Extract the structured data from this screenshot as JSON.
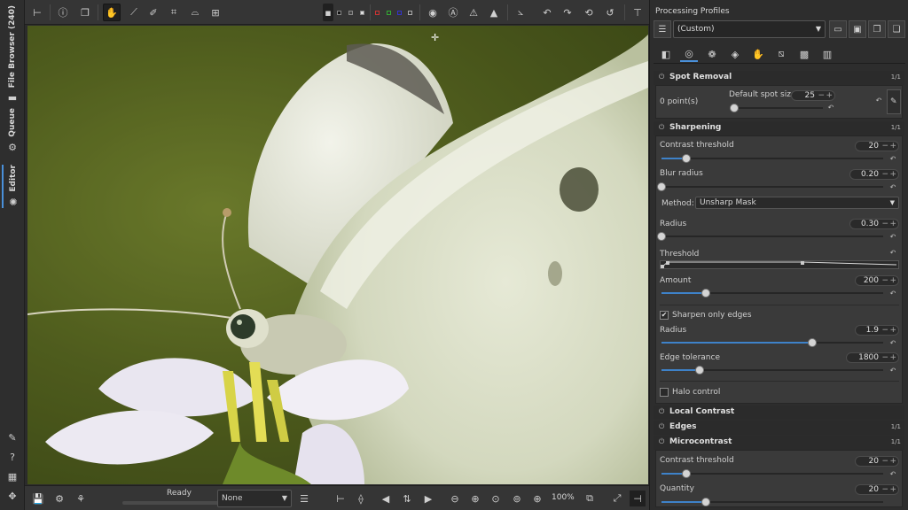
{
  "left_bar": {
    "tabs": [
      {
        "label": "File Browser (240)",
        "icon": "folder-icon"
      },
      {
        "label": "Queue",
        "icon": "gears-icon"
      },
      {
        "label": "Editor",
        "icon": "aperture-icon"
      }
    ],
    "bottom_icons": [
      "pipette-icon",
      "help-icon",
      "shortcuts-icon",
      "move-icon"
    ]
  },
  "top_toolbar": {
    "tools": [
      "hide-panel-icon",
      "info-icon",
      "before-after-icon",
      "hand-icon",
      "white-balance-picker-icon",
      "color-picker-icon",
      "crop-icon",
      "straighten-icon",
      "perspective-icon"
    ],
    "active_tool": "hand-icon",
    "right_tools": [
      "focus-mask-icon",
      "clip-shadows-icon",
      "clip-highlights-icon",
      "clip-warning-icon",
      "histogram-icon",
      "rotate-left-icon",
      "rotate-right-icon",
      "flip-icon",
      "undo-icon",
      "transform-icon"
    ]
  },
  "bottom_toolbar": {
    "status": "Ready",
    "progress": 0,
    "preview_mode": "None",
    "zoom_label": "100%"
  },
  "right_panel": {
    "title": "Processing Profiles",
    "profile_value": "(Custom)",
    "tool_tabs": [
      "exposure-tab-icon",
      "detail-tab-icon",
      "color-tab-icon",
      "advanced-tab-icon",
      "transform-tab-icon",
      "raw-tab-icon",
      "locallab-tab-icon",
      "meta-tab-icon"
    ],
    "active_tab": 1,
    "spot_removal": {
      "title": "Spot Removal",
      "indicator": "1/1",
      "points_label": "0 point(s)",
      "spot_size_label": "Default spot size",
      "spot_size_value": "25",
      "spot_size_fraction": 0.04
    },
    "sharpening": {
      "title": "Sharpening",
      "indicator": "1/1",
      "contrast_threshold_label": "Contrast threshold",
      "contrast_threshold_value": "20",
      "contrast_threshold_fraction": 0.11,
      "blur_radius_label": "Blur radius",
      "blur_radius_value": "0.20",
      "blur_radius_fraction": 0.0,
      "method_label": "Method:",
      "method_value": "Unsharp Mask",
      "radius_label": "Radius",
      "radius_value": "0.30",
      "radius_fraction": 0.0,
      "threshold_label": "Threshold",
      "amount_label": "Amount",
      "amount_value": "200",
      "amount_fraction": 0.2,
      "sharpen_edges_label": "Sharpen only edges",
      "sharpen_edges_checked": true,
      "edge_radius_label": "Radius",
      "edge_radius_value": "1.9",
      "edge_radius_fraction": 0.68,
      "edge_tolerance_label": "Edge tolerance",
      "edge_tolerance_value": "1800",
      "edge_tolerance_fraction": 0.17,
      "halo_label": "Halo control",
      "halo_checked": false
    },
    "local_contrast": {
      "title": "Local Contrast"
    },
    "edges": {
      "title": "Edges",
      "indicator": "1/1"
    },
    "microcontrast": {
      "title": "Microcontrast",
      "indicator": "1/1",
      "contrast_threshold_label": "Contrast threshold",
      "contrast_threshold_value": "20",
      "contrast_threshold_fraction": 0.11,
      "quantity_label": "Quantity",
      "quantity_value": "20",
      "quantity_fraction": 0.2
    }
  }
}
